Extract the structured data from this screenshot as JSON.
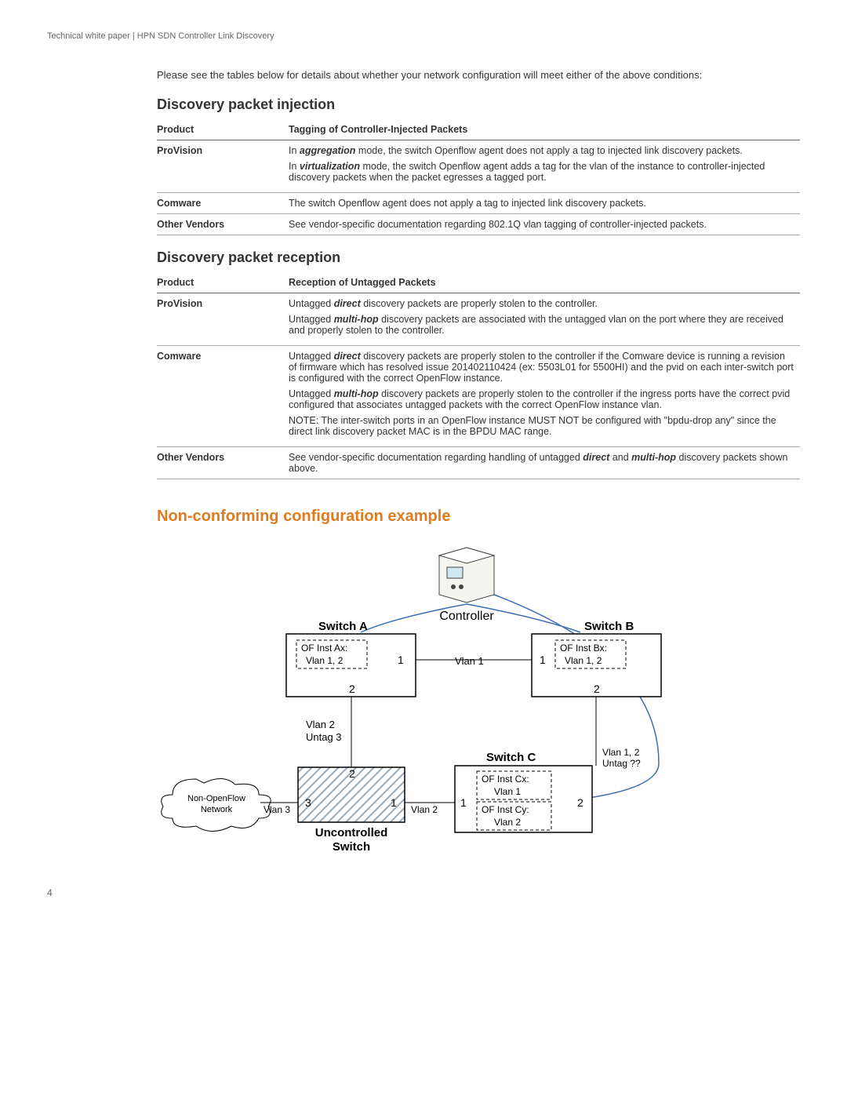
{
  "header": "Technical white paper  |  HPN SDN Controller Link Discovery",
  "intro": "Please see the tables below for details about whether your network configuration will meet either of the above conditions:",
  "section1_title": "Discovery packet injection",
  "table1": {
    "col1": "Product",
    "col2": "Tagging of Controller-Injected Packets",
    "rows": [
      {
        "product": "ProVision",
        "details_html": "<div class='block'>In <strong><em>aggregation</em></strong> mode, the switch Openflow agent does not apply a tag to injected link discovery packets.</div><div class='block'>In <strong><em>virtualization</em></strong> mode, the switch Openflow agent adds a tag for the vlan of the instance to controller-injected discovery packets when the packet egresses a tagged port.</div>"
      },
      {
        "product": "Comware",
        "details_html": "The switch Openflow agent does not apply a tag to injected link discovery packets."
      },
      {
        "product": "Other Vendors",
        "details_html": "See vendor-specific documentation regarding 802.1Q vlan tagging of controller-injected packets."
      }
    ]
  },
  "section2_title": "Discovery packet reception",
  "table2": {
    "col1": "Product",
    "col2": "Reception of Untagged Packets",
    "rows": [
      {
        "product": "ProVision",
        "details_html": "<div class='block'>Untagged <strong><em>direct</em></strong> discovery packets are properly stolen to the controller.</div><div class='block'>Untagged <strong><em>multi-hop</em></strong> discovery packets are associated with the untagged vlan on the port where they are received and properly stolen to the controller.</div>"
      },
      {
        "product": "Comware",
        "details_html": "<div class='block'>Untagged <strong><em>direct</em></strong> discovery packets are properly stolen to the controller if the Comware device is running a revision of firmware which has resolved issue 201402110424 (ex:  5503L01 for 5500HI) and the pvid on each inter-switch port is configured with the correct OpenFlow instance.</div><div class='block'>Untagged <strong><em>multi-hop</em></strong> discovery packets are properly stolen to the controller if the ingress ports have the correct pvid configured that associates untagged packets with the correct OpenFlow instance vlan.</div><div class='block'>NOTE: The inter-switch ports in an OpenFlow instance MUST NOT be configured with \"bpdu-drop any\" since the direct link discovery packet MAC is in the BPDU MAC range.</div>"
      },
      {
        "product": "Other Vendors",
        "details_html": "See vendor-specific documentation regarding handling of untagged <strong><em>direct</em></strong> and <strong><em>multi-hop</em></strong> discovery packets shown above."
      }
    ]
  },
  "orange_heading": "Non-conforming configuration example",
  "diagram": {
    "controller": "Controller",
    "switchA": "Switch A",
    "switchB": "Switch B",
    "switchC": "Switch C",
    "uncontrolled": "Uncontrolled\nSwitch",
    "nonOF": "Non-OpenFlow\nNetwork",
    "ofAx": "OF Inst Ax:",
    "ofAx2": "Vlan 1, 2",
    "ofBx": "OF Inst Bx:",
    "ofBx2": "Vlan 1, 2",
    "ofCx": "OF Inst Cx:",
    "ofCx2": "Vlan 1",
    "ofCy": "OF Inst Cy:",
    "ofCy2": "Vlan 2",
    "vlan1_link": "Vlan 1",
    "vlan2_untag3": "Vlan 2\nUntag 3",
    "vlan12_untag": "Vlan 1, 2\nUntag ??",
    "vlan2": "Vlan 2",
    "vlan3": "Vlan 3",
    "p1": "1",
    "p2": "2",
    "p3": "3"
  },
  "page_number": "4"
}
